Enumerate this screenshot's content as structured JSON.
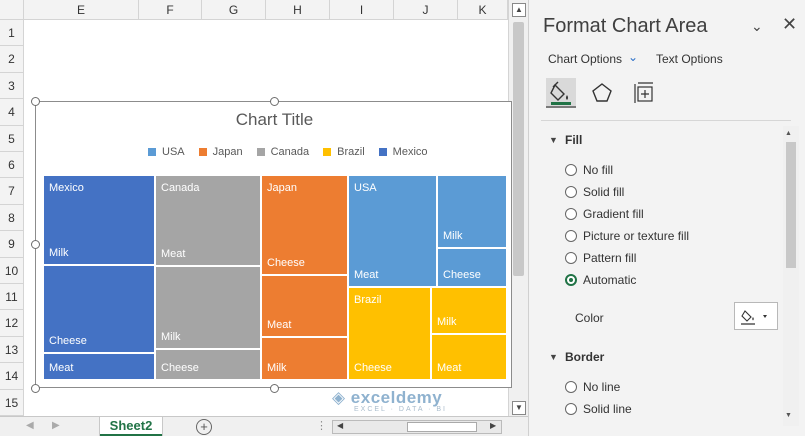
{
  "sheet": {
    "columns": [
      "E",
      "F",
      "G",
      "H",
      "I",
      "J",
      "K"
    ],
    "rows": [
      "1",
      "2",
      "3",
      "4",
      "5",
      "6",
      "7",
      "8",
      "9",
      "10",
      "11",
      "12",
      "13",
      "14",
      "15"
    ],
    "active_tab": "Sheet2"
  },
  "chart": {
    "title": "Chart Title",
    "legend": [
      {
        "label": "USA",
        "color": "#5b9bd5"
      },
      {
        "label": "Japan",
        "color": "#ed7d31"
      },
      {
        "label": "Canada",
        "color": "#a5a5a5"
      },
      {
        "label": "Brazil",
        "color": "#ffc000"
      },
      {
        "label": "Mexico",
        "color": "#4472c4"
      }
    ]
  },
  "chart_data": {
    "type": "treemap",
    "title": "Chart Title",
    "groups": [
      {
        "name": "Mexico",
        "color": "#4472c4",
        "items": [
          "Milk",
          "Cheese",
          "Meat"
        ]
      },
      {
        "name": "Canada",
        "color": "#a5a5a5",
        "items": [
          "Meat",
          "Milk",
          "Cheese"
        ]
      },
      {
        "name": "Japan",
        "color": "#ed7d31",
        "items": [
          "Cheese",
          "Meat",
          "Milk"
        ]
      },
      {
        "name": "USA",
        "color": "#5b9bd5",
        "items": [
          "Meat",
          "Milk",
          "Cheese"
        ]
      },
      {
        "name": "Brazil",
        "color": "#ffc000",
        "items": [
          "Cheese",
          "Milk",
          "Meat"
        ]
      }
    ]
  },
  "pane": {
    "title": "Format Chart Area",
    "chart_options": "Chart Options",
    "text_options": "Text Options",
    "fill_section": "Fill",
    "fill_options": [
      "No fill",
      "Solid fill",
      "Gradient fill",
      "Picture or texture fill",
      "Pattern fill",
      "Automatic"
    ],
    "selected_fill": "Automatic",
    "color_label": "Color",
    "border_section": "Border",
    "border_options": [
      "No line",
      "Solid line"
    ]
  },
  "watermark": {
    "name": "exceldemy",
    "tagline": "EXCEL · DATA · BI"
  }
}
